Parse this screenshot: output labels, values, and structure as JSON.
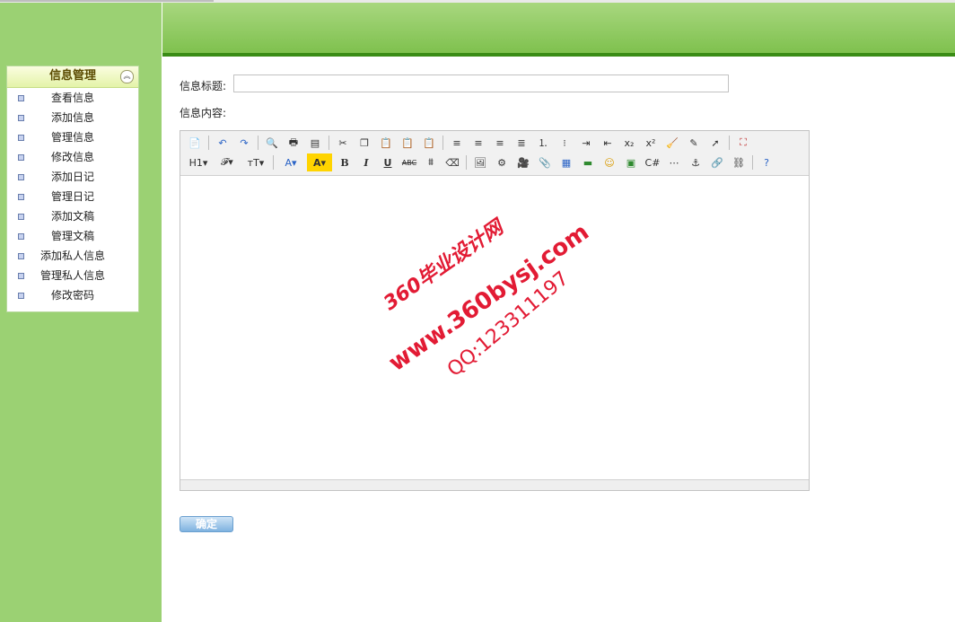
{
  "sidebar": {
    "header": "信息管理",
    "toggle_glyph": "«",
    "items": [
      {
        "label": "查看信息"
      },
      {
        "label": "添加信息"
      },
      {
        "label": "管理信息"
      },
      {
        "label": "修改信息"
      },
      {
        "label": "添加日记"
      },
      {
        "label": "管理日记"
      },
      {
        "label": "添加文稿"
      },
      {
        "label": "管理文稿"
      },
      {
        "label": "添加私人信息"
      },
      {
        "label": "管理私人信息"
      },
      {
        "label": "修改密码"
      }
    ]
  },
  "form": {
    "title_label": "信息标题:",
    "title_value": "",
    "content_label": "信息内容:",
    "submit_label": "确定"
  },
  "editor": {
    "toolbar_row1": [
      {
        "icon": "source-icon",
        "glyph": "📄"
      },
      {
        "sep": true
      },
      {
        "icon": "undo-icon",
        "glyph": "↶",
        "color": "#2a63c6"
      },
      {
        "icon": "redo-icon",
        "glyph": "↷",
        "color": "#2a63c6"
      },
      {
        "sep": true
      },
      {
        "icon": "preview-icon",
        "glyph": "🔍"
      },
      {
        "icon": "print-icon",
        "glyph": "🖶"
      },
      {
        "icon": "template-icon",
        "glyph": "▤"
      },
      {
        "sep": true
      },
      {
        "icon": "cut-icon",
        "glyph": "✂"
      },
      {
        "icon": "copy-icon",
        "glyph": "❐"
      },
      {
        "icon": "paste-icon",
        "glyph": "📋"
      },
      {
        "icon": "paste-text-icon",
        "glyph": "📋"
      },
      {
        "icon": "paste-word-icon",
        "glyph": "📋"
      },
      {
        "sep": true
      },
      {
        "icon": "align-left-icon",
        "glyph": "≡"
      },
      {
        "icon": "align-center-icon",
        "glyph": "≡"
      },
      {
        "icon": "align-right-icon",
        "glyph": "≡"
      },
      {
        "icon": "align-justify-icon",
        "glyph": "≣"
      },
      {
        "icon": "ordered-list-icon",
        "glyph": "⒈"
      },
      {
        "icon": "unordered-list-icon",
        "glyph": "⁝"
      },
      {
        "icon": "indent-icon",
        "glyph": "⇥"
      },
      {
        "icon": "outdent-icon",
        "glyph": "⇤"
      },
      {
        "icon": "subscript-icon",
        "glyph": "x₂"
      },
      {
        "icon": "superscript-icon",
        "glyph": "x²"
      },
      {
        "icon": "clear-format-icon",
        "glyph": "🧹"
      },
      {
        "icon": "edit-icon",
        "glyph": "✎"
      },
      {
        "icon": "select-all-icon",
        "glyph": "➚"
      },
      {
        "sep": true
      },
      {
        "icon": "fullscreen-icon",
        "glyph": "⛶",
        "color": "#c03030"
      }
    ],
    "toolbar_row2": [
      {
        "icon": "heading-icon",
        "glyph": "H1▾",
        "wide": true
      },
      {
        "icon": "font-family-icon",
        "glyph": "𝓕▾",
        "wide": true
      },
      {
        "icon": "font-size-icon",
        "glyph": "тT▾",
        "wide": true
      },
      {
        "sep": true
      },
      {
        "icon": "font-color-icon",
        "glyph": "A▾",
        "color": "#2a63c6",
        "wide": true
      },
      {
        "icon": "highlight-icon",
        "glyph": "A▾",
        "bg": "#ffd400",
        "wide": true
      },
      {
        "icon": "bold-icon",
        "glyph": "B"
      },
      {
        "icon": "italic-icon",
        "glyph": "I"
      },
      {
        "icon": "underline-icon",
        "glyph": "U"
      },
      {
        "icon": "strikethrough-icon",
        "glyph": "ABC"
      },
      {
        "icon": "line-height-icon",
        "glyph": "⩩"
      },
      {
        "icon": "remove-format-icon",
        "glyph": "⌫"
      },
      {
        "sep": true
      },
      {
        "icon": "image-icon",
        "glyph": "🖼"
      },
      {
        "icon": "flash-icon",
        "glyph": "⚙"
      },
      {
        "icon": "media-icon",
        "glyph": "🎥"
      },
      {
        "icon": "attachment-icon",
        "glyph": "📎"
      },
      {
        "icon": "table-icon",
        "glyph": "▦",
        "color": "#2a63c6"
      },
      {
        "icon": "hr-icon",
        "glyph": "▬",
        "color": "#2f8a2f"
      },
      {
        "icon": "emoticon-icon",
        "glyph": "☺",
        "color": "#d99a00"
      },
      {
        "icon": "gallery-icon",
        "glyph": "▣",
        "color": "#2f8a2f"
      },
      {
        "icon": "code-icon",
        "glyph": "C#"
      },
      {
        "icon": "page-break-icon",
        "glyph": "⋯"
      },
      {
        "icon": "anchor-icon",
        "glyph": "⚓"
      },
      {
        "icon": "link-icon",
        "glyph": "🔗"
      },
      {
        "icon": "unlink-icon",
        "glyph": "⛓"
      },
      {
        "sep": true
      },
      {
        "icon": "help-icon",
        "glyph": "?",
        "color": "#2a63c6"
      }
    ]
  },
  "watermark": {
    "line1": "360毕业设计网",
    "line2": "www.360bysj.com",
    "line3": "QQ:123311197"
  }
}
